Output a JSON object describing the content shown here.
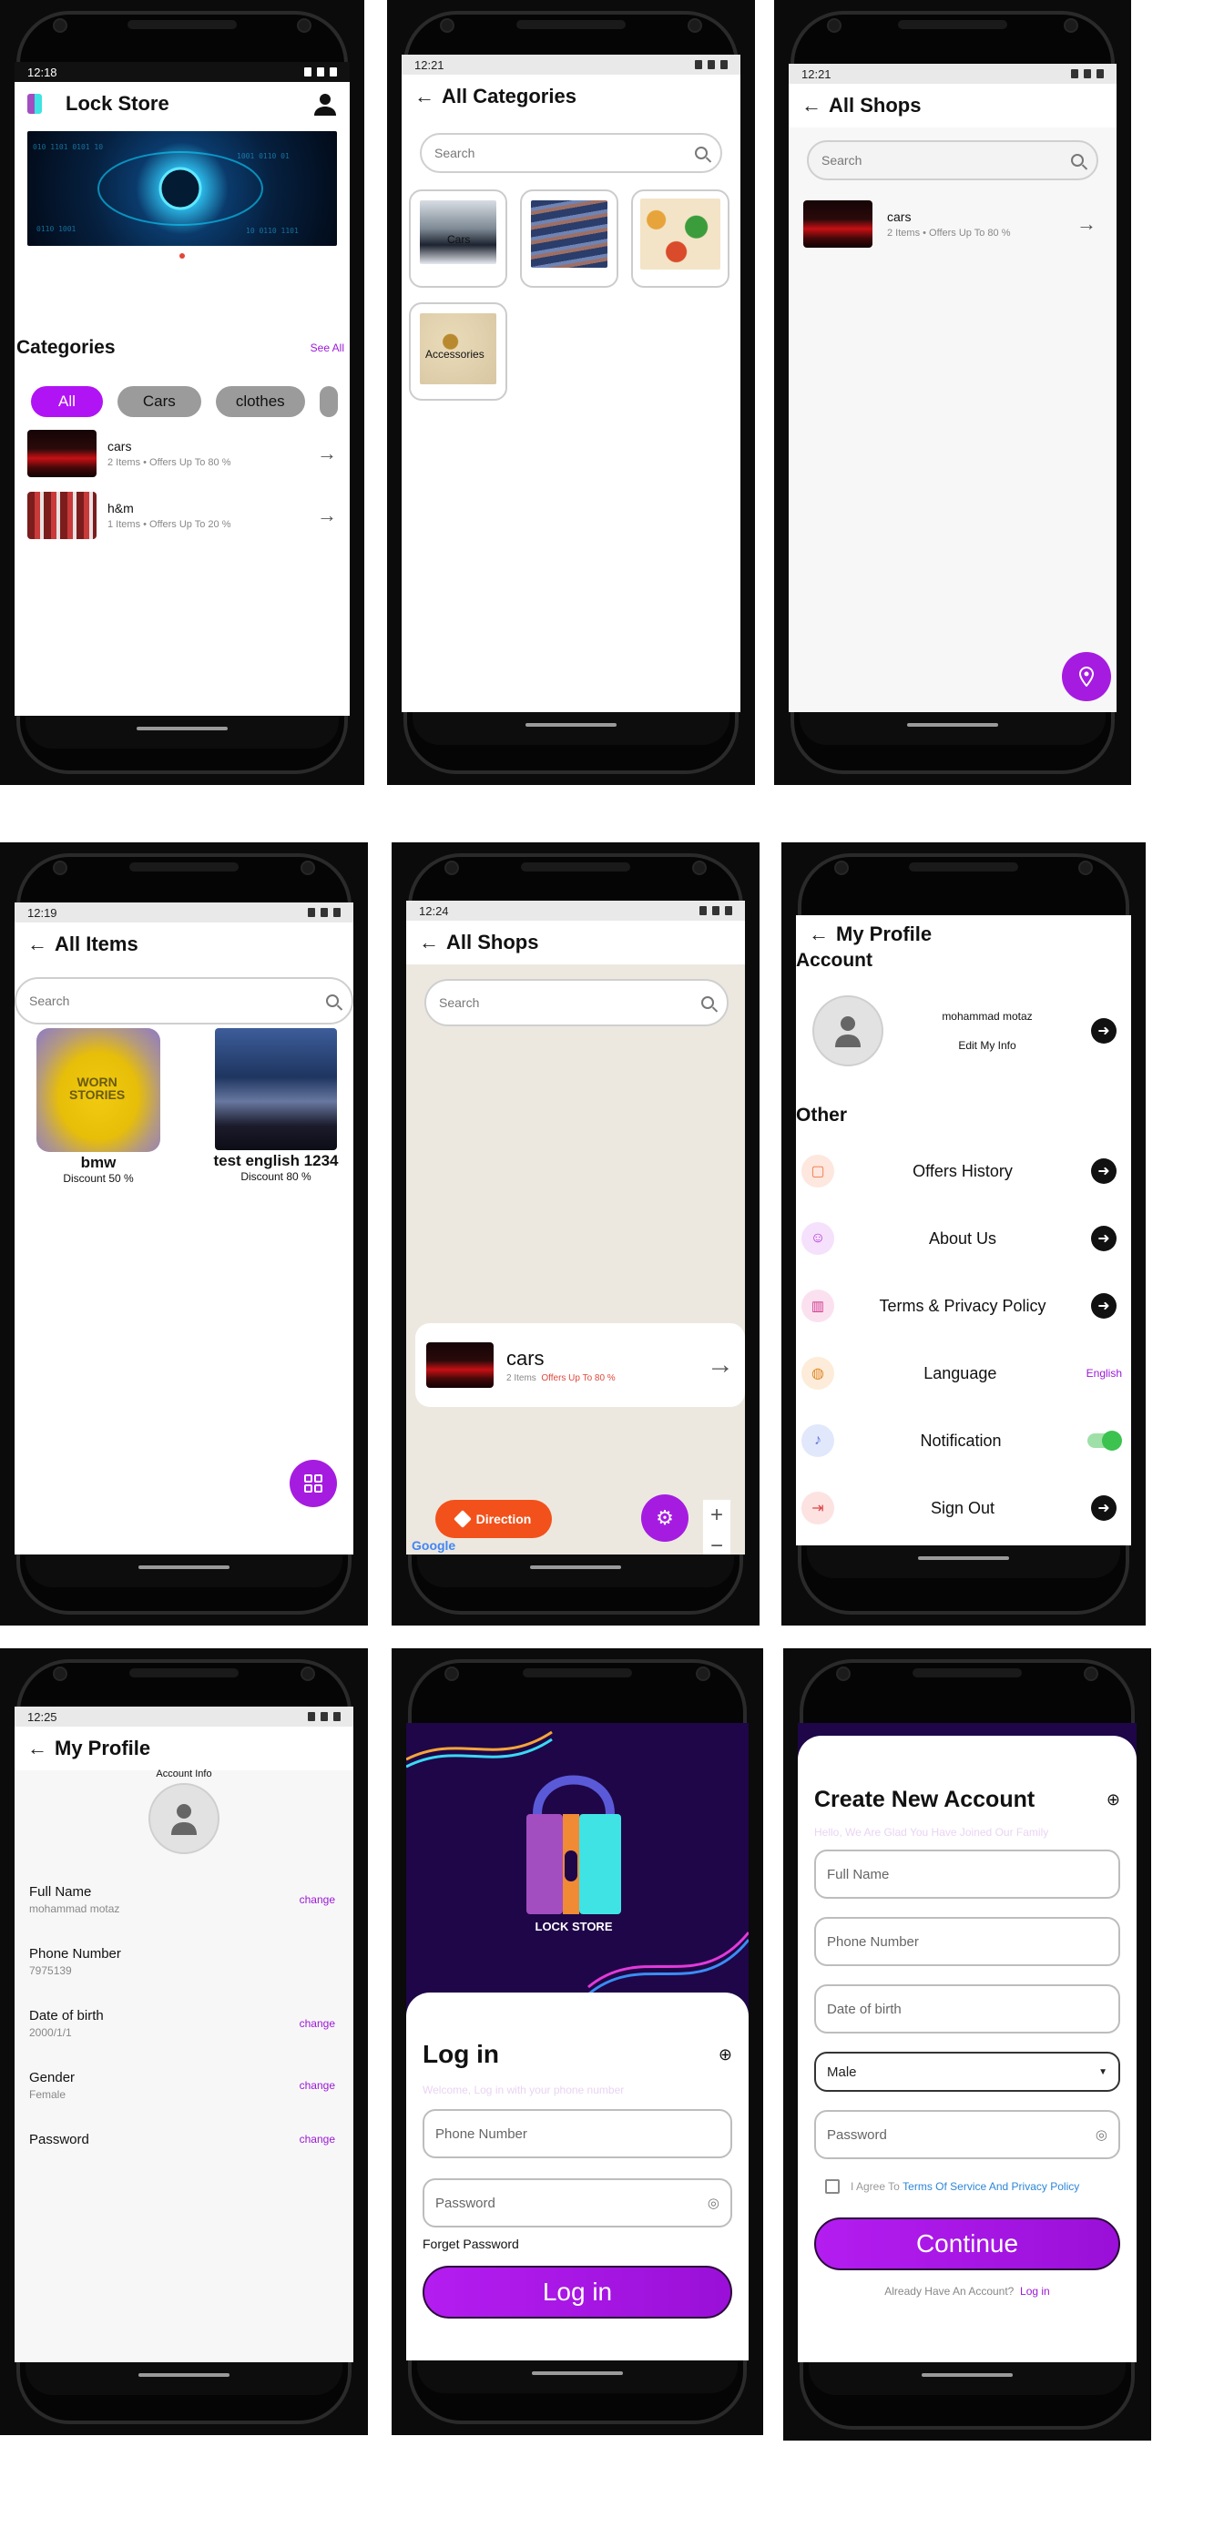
{
  "s1": {
    "time": "12:18",
    "title": "Lock Store",
    "categories_title": "Categories",
    "see_all": "See All",
    "chips": [
      "All",
      "Cars",
      "clothes"
    ],
    "shops": [
      {
        "name": "cars",
        "meta": "2 Items  •  Offers Up To 80 %"
      },
      {
        "name": "h&m",
        "meta": "1 Items  •  Offers Up To 20 %"
      }
    ]
  },
  "s2": {
    "time": "12:21",
    "title": "All Categories",
    "search_placeholder": "Search",
    "cards": [
      "Cars",
      "",
      "",
      "Accessories"
    ]
  },
  "s3": {
    "time": "12:21",
    "title": "All Shops",
    "search_placeholder": "Search",
    "shop": {
      "name": "cars",
      "meta": "2 Items  •  Offers Up To 80 %"
    }
  },
  "s4": {
    "time": "12:19",
    "title": "All Items",
    "search_placeholder": "Search",
    "items": [
      {
        "name": "bmw",
        "discount": "Discount 50 %"
      },
      {
        "name": "test english 1234",
        "discount": "Discount 80 %"
      }
    ]
  },
  "s5": {
    "time": "12:24",
    "title": "All Shops",
    "search_placeholder": "Search",
    "shop": {
      "name": "cars",
      "items": "2 Items",
      "offer": "Offers Up To 80 %"
    },
    "direction": "Direction",
    "zoom_in": "+",
    "zoom_out": "−",
    "google": "Google"
  },
  "s6": {
    "title": "My Profile",
    "account": "Account",
    "user_name": "mohammad motaz",
    "edit": "Edit My Info",
    "other": "Other",
    "menu": [
      "Offers History",
      "About Us",
      "Terms & Privacy Policy",
      "Language",
      "Notification",
      "Sign Out"
    ],
    "language_value": "English"
  },
  "s7": {
    "time": "12:25",
    "title": "My Profile",
    "account_info": "Account Info",
    "fields": [
      {
        "label": "Full Name",
        "value": "mohammad motaz",
        "action": "change"
      },
      {
        "label": "Phone Number",
        "value": "7975139",
        "action": ""
      },
      {
        "label": "Date of birth",
        "value": "2000/1/1",
        "action": "change"
      },
      {
        "label": "Gender",
        "value": "Female",
        "action": "change"
      },
      {
        "label": "Password",
        "value": "",
        "action": "change"
      }
    ]
  },
  "s8": {
    "brand": "LOCK STORE",
    "title": "Log in",
    "subtitle": "Welcome, Log in with your phone number",
    "phone": "Phone Number",
    "password": "Password",
    "forget": "Forget Password",
    "button": "Log in"
  },
  "s9": {
    "title": "Create New Account",
    "subtitle": "Hello, We Are Glad You Have Joined Our Family",
    "full_name": "Full Name",
    "phone": "Phone Number",
    "dob": "Date of birth",
    "gender": "Male",
    "password": "Password",
    "agree": "I Agree To",
    "terms": "Terms Of Service And Privacy Policy",
    "button": "Continue",
    "have_account": "Already Have An Account?",
    "login": "Log in"
  }
}
